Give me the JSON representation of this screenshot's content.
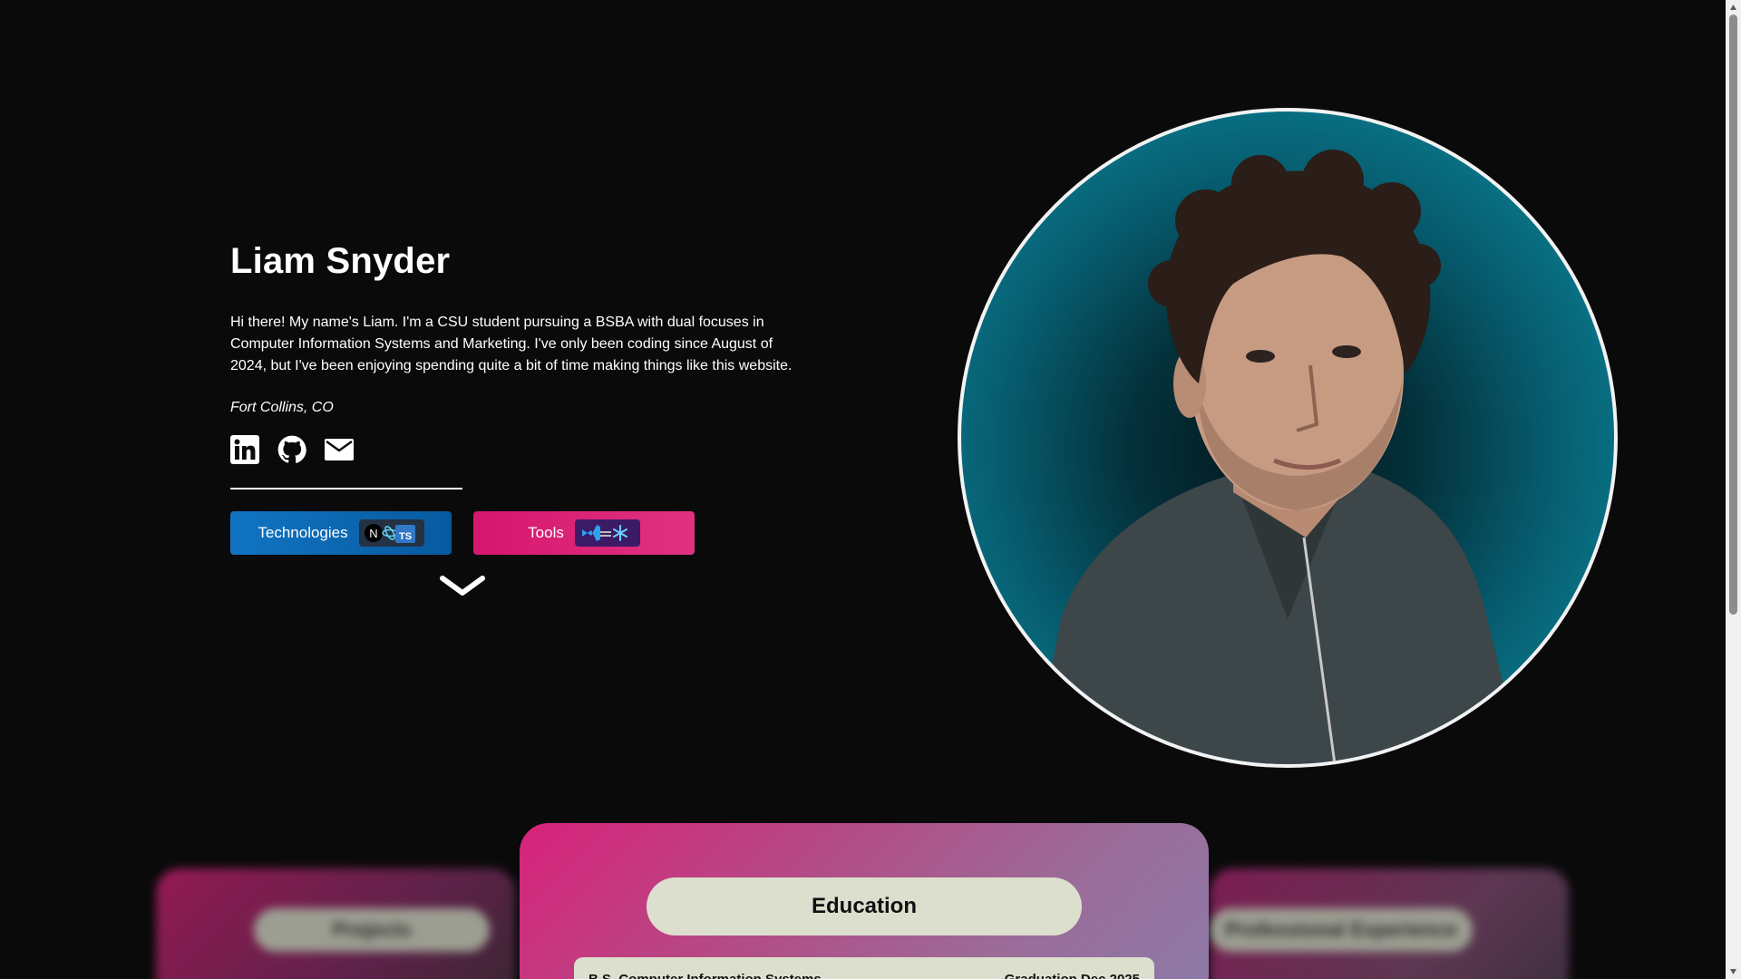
{
  "hero": {
    "name": "Liam Snyder",
    "bio": "Hi there! My name's Liam. I'm a CSU student pursuing a BSBA with dual focuses in Computer Information Systems and Marketing. I've only been coding since August of 2024, but I've been enjoying spending quite a bit of time making things like this website.",
    "location": "Fort Collins, CO",
    "socials": [
      {
        "icon": "linkedin-icon"
      },
      {
        "icon": "github-icon"
      },
      {
        "icon": "mail-icon"
      }
    ],
    "buttons": {
      "technologies_label": "Technologies",
      "tools_label": "Tools"
    }
  },
  "cards": {
    "left_title": "Projects",
    "main_title": "Education",
    "right_title": "Professional Experience",
    "main_entry_left": "B.S. Computer Information Systems",
    "main_entry_right": "Graduation Dec 2025"
  },
  "colors": {
    "background": "#0a0a0b",
    "technologies_button": "#0d6dbb",
    "tools_button": "#d91a72",
    "portrait_bg": "#0a7a8e",
    "card_pill": "#dcdfcd"
  }
}
